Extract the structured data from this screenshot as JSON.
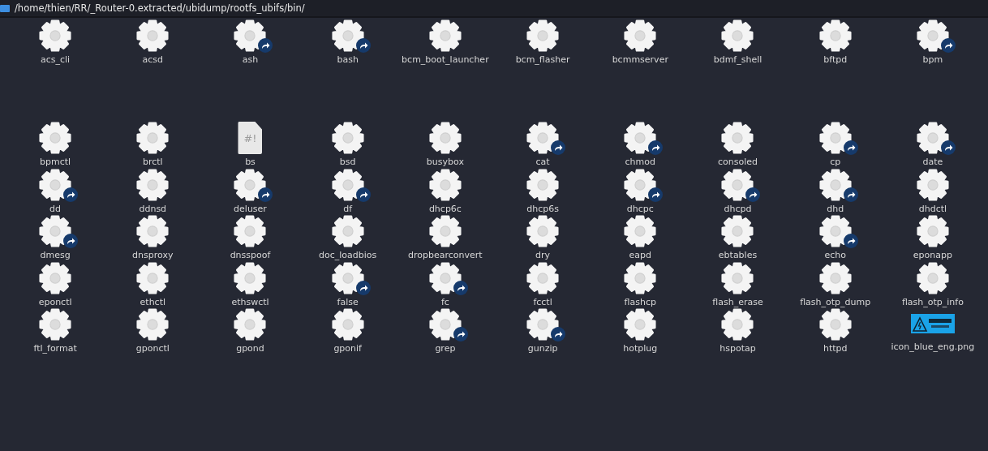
{
  "location_bar": {
    "path": "/home/thien/RR/_Router-0.extracted/ubidump/rootfs_ubifs/bin/"
  },
  "files": [
    {
      "name": "acs_cli",
      "kind": "executable",
      "link": false
    },
    {
      "name": "acsd",
      "kind": "executable",
      "link": false
    },
    {
      "name": "ash",
      "kind": "executable",
      "link": true
    },
    {
      "name": "bash",
      "kind": "executable",
      "link": true
    },
    {
      "name": "bcm_boot_launcher",
      "kind": "executable",
      "link": false
    },
    {
      "name": "bcm_flasher",
      "kind": "executable",
      "link": false
    },
    {
      "name": "bcmmserver",
      "kind": "executable",
      "link": false
    },
    {
      "name": "bdmf_shell",
      "kind": "executable",
      "link": false
    },
    {
      "name": "bftpd",
      "kind": "executable",
      "link": false
    },
    {
      "name": "bpm",
      "kind": "executable",
      "link": true
    },
    {
      "name": "bpmctl",
      "kind": "executable",
      "link": false
    },
    {
      "name": "brctl",
      "kind": "executable",
      "link": false
    },
    {
      "name": "bs",
      "kind": "script",
      "glyph": "#!",
      "link": false
    },
    {
      "name": "bsd",
      "kind": "executable",
      "link": false
    },
    {
      "name": "busybox",
      "kind": "executable",
      "link": false
    },
    {
      "name": "cat",
      "kind": "executable",
      "link": true
    },
    {
      "name": "chmod",
      "kind": "executable",
      "link": true
    },
    {
      "name": "consoled",
      "kind": "executable",
      "link": false
    },
    {
      "name": "cp",
      "kind": "executable",
      "link": true
    },
    {
      "name": "date",
      "kind": "executable",
      "link": true
    },
    {
      "name": "dd",
      "kind": "executable",
      "link": true
    },
    {
      "name": "ddnsd",
      "kind": "executable",
      "link": false
    },
    {
      "name": "deluser",
      "kind": "executable",
      "link": true
    },
    {
      "name": "df",
      "kind": "executable",
      "link": true
    },
    {
      "name": "dhcp6c",
      "kind": "executable",
      "link": false
    },
    {
      "name": "dhcp6s",
      "kind": "executable",
      "link": false
    },
    {
      "name": "dhcpc",
      "kind": "executable",
      "link": true
    },
    {
      "name": "dhcpd",
      "kind": "executable",
      "link": true
    },
    {
      "name": "dhd",
      "kind": "executable",
      "link": true
    },
    {
      "name": "dhdctl",
      "kind": "executable",
      "link": false
    },
    {
      "name": "dmesg",
      "kind": "executable",
      "link": true
    },
    {
      "name": "dnsproxy",
      "kind": "executable",
      "link": false
    },
    {
      "name": "dnsspoof",
      "kind": "executable",
      "link": false
    },
    {
      "name": "doc_loadbios",
      "kind": "executable",
      "link": false
    },
    {
      "name": "dropbearconvert",
      "kind": "executable",
      "link": false
    },
    {
      "name": "dry",
      "kind": "executable",
      "link": false
    },
    {
      "name": "eapd",
      "kind": "executable",
      "link": false
    },
    {
      "name": "ebtables",
      "kind": "executable",
      "link": false
    },
    {
      "name": "echo",
      "kind": "executable",
      "link": true
    },
    {
      "name": "eponapp",
      "kind": "executable",
      "link": false
    },
    {
      "name": "eponctl",
      "kind": "executable",
      "link": false
    },
    {
      "name": "ethctl",
      "kind": "executable",
      "link": false
    },
    {
      "name": "ethswctl",
      "kind": "executable",
      "link": false
    },
    {
      "name": "false",
      "kind": "executable",
      "link": true
    },
    {
      "name": "fc",
      "kind": "executable",
      "link": true
    },
    {
      "name": "fcctl",
      "kind": "executable",
      "link": false
    },
    {
      "name": "flashcp",
      "kind": "executable",
      "link": false
    },
    {
      "name": "flash_erase",
      "kind": "executable",
      "link": false
    },
    {
      "name": "flash_otp_dump",
      "kind": "executable",
      "link": false
    },
    {
      "name": "flash_otp_info",
      "kind": "executable",
      "link": false
    },
    {
      "name": "ftl_format",
      "kind": "executable",
      "link": false
    },
    {
      "name": "gponctl",
      "kind": "executable",
      "link": false
    },
    {
      "name": "gpond",
      "kind": "executable",
      "link": false
    },
    {
      "name": "gponif",
      "kind": "executable",
      "link": false
    },
    {
      "name": "grep",
      "kind": "executable",
      "link": true
    },
    {
      "name": "gunzip",
      "kind": "executable",
      "link": true
    },
    {
      "name": "hotplug",
      "kind": "executable",
      "link": false
    },
    {
      "name": "hspotap",
      "kind": "executable",
      "link": false
    },
    {
      "name": "httpd",
      "kind": "executable",
      "link": false
    },
    {
      "name": "icon_blue_eng.png",
      "link": false
    }
  ]
}
